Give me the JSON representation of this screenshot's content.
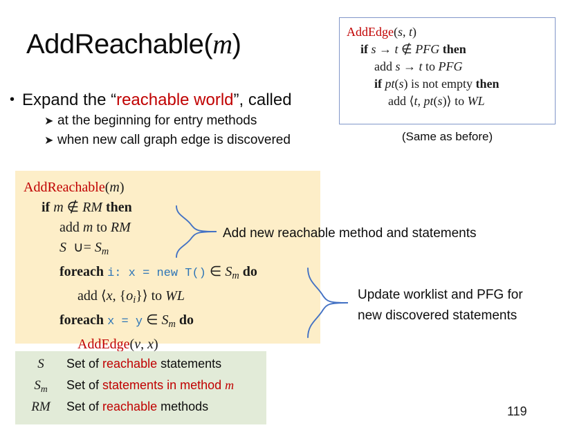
{
  "slide": {
    "title_main": "AddReachable(",
    "title_var": "m",
    "title_close": ")",
    "page_number": "119"
  },
  "bullets": {
    "main": {
      "marker": "•",
      "pre": "Expand the “",
      "highlight": "reachable world",
      "post": "”, called"
    },
    "sub": [
      {
        "marker": "➤",
        "text": "at the beginning for entry methods"
      },
      {
        "marker": "➤",
        "text": "when new call graph edge is discovered"
      }
    ]
  },
  "addedge_box": {
    "border_color": "#8096c8",
    "lines": [
      {
        "indent": 0,
        "parts": [
          {
            "t": "AddEdge",
            "style": "proc"
          },
          {
            "t": "(",
            "style": "plain"
          },
          {
            "t": "s",
            "style": "italic"
          },
          {
            "t": ", ",
            "style": "plain"
          },
          {
            "t": "t",
            "style": "italic"
          },
          {
            "t": ")",
            "style": "plain"
          }
        ]
      },
      {
        "indent": 1,
        "parts": [
          {
            "t": "if",
            "style": "kw"
          },
          {
            "t": " ",
            "style": "plain"
          },
          {
            "t": "s",
            "style": "italic"
          },
          {
            "t": " → ",
            "style": "plain"
          },
          {
            "t": "t",
            "style": "italic"
          },
          {
            "t": " ∉ ",
            "style": "plain"
          },
          {
            "t": "PFG",
            "style": "italic"
          },
          {
            "t": " ",
            "style": "plain"
          },
          {
            "t": "then",
            "style": "kw"
          }
        ]
      },
      {
        "indent": 2,
        "parts": [
          {
            "t": "add ",
            "style": "plain"
          },
          {
            "t": "s",
            "style": "italic"
          },
          {
            "t": " → ",
            "style": "plain"
          },
          {
            "t": "t",
            "style": "italic"
          },
          {
            "t": " to ",
            "style": "plain"
          },
          {
            "t": "PFG",
            "style": "italic"
          }
        ]
      },
      {
        "indent": 2,
        "parts": [
          {
            "t": "if",
            "style": "kw"
          },
          {
            "t": " ",
            "style": "plain"
          },
          {
            "t": "pt",
            "style": "italic"
          },
          {
            "t": "(",
            "style": "plain"
          },
          {
            "t": "s",
            "style": "italic"
          },
          {
            "t": ") is not empty ",
            "style": "plain"
          },
          {
            "t": "then",
            "style": "kw"
          }
        ]
      },
      {
        "indent": 3,
        "parts": [
          {
            "t": "add ⟨",
            "style": "plain"
          },
          {
            "t": "t",
            "style": "italic"
          },
          {
            "t": ", ",
            "style": "plain"
          },
          {
            "t": "pt",
            "style": "italic"
          },
          {
            "t": "(",
            "style": "plain"
          },
          {
            "t": "s",
            "style": "italic"
          },
          {
            "t": ")⟩ to ",
            "style": "plain"
          },
          {
            "t": "WL",
            "style": "italic"
          }
        ]
      }
    ],
    "caption": "(Same as before)"
  },
  "addreachable_box": {
    "background": "#fdeec8",
    "lines": [
      {
        "indent": 0,
        "html": "<span class='proc'>AddReachable</span>(<span class='it'>m</span>)"
      },
      {
        "indent": 1,
        "html": "<span class='kw'>if</span> <span class='it'>m</span> ∉ <span class='it'>RM</span> <span class='kw'>then</span>"
      },
      {
        "indent": 2,
        "html": "add <span class='it'>m</span> to <span class='it'>RM</span>"
      },
      {
        "indent": 2,
        "html": "<span class='it'>S</span> &nbsp;∪= <span class='it'>S<span class='sub'>m</span></span>"
      },
      {
        "indent": 2,
        "html": "<span class='kw'>foreach</span> <span class='mono'>i: x = new T()</span> ∈ <span class='it'>S<span class='sub'>m</span></span> <span class='kw'>do</span>"
      },
      {
        "indent": 3,
        "html": "add ⟨<span class='it'>x</span>, {<span class='it'>o<span class='sub'>i</span></span>}⟩ to <span class='it'>WL</span>"
      },
      {
        "indent": 2,
        "html": "<span class='kw'>foreach</span> <span class='mono'>x = y</span> ∈ <span class='it'>S<span class='sub'>m</span></span> <span class='kw'>do</span>"
      },
      {
        "indent": 3,
        "html": "<span class='proc'>AddEdge</span>(<span class='it'>v</span>, <span class='it'>x</span>)"
      }
    ]
  },
  "annotations": {
    "brace_color": "#4472c4",
    "note1": "Add new reachable method and statements",
    "note2_line1": "Update worklist and PFG for",
    "note2_line2": "new discovered statements"
  },
  "legend": {
    "background": "#e2ebd8",
    "rows": [
      {
        "symbol": "S",
        "pre": "Set of ",
        "highlight": "reachable",
        "post": " statements",
        "var": ""
      },
      {
        "symbol": "Sm",
        "pre": "Set of ",
        "highlight": "statements in method",
        "post": " ",
        "var": "m"
      },
      {
        "symbol": "RM",
        "pre": "Set of ",
        "highlight": "reachable",
        "post": " methods",
        "var": ""
      }
    ]
  }
}
